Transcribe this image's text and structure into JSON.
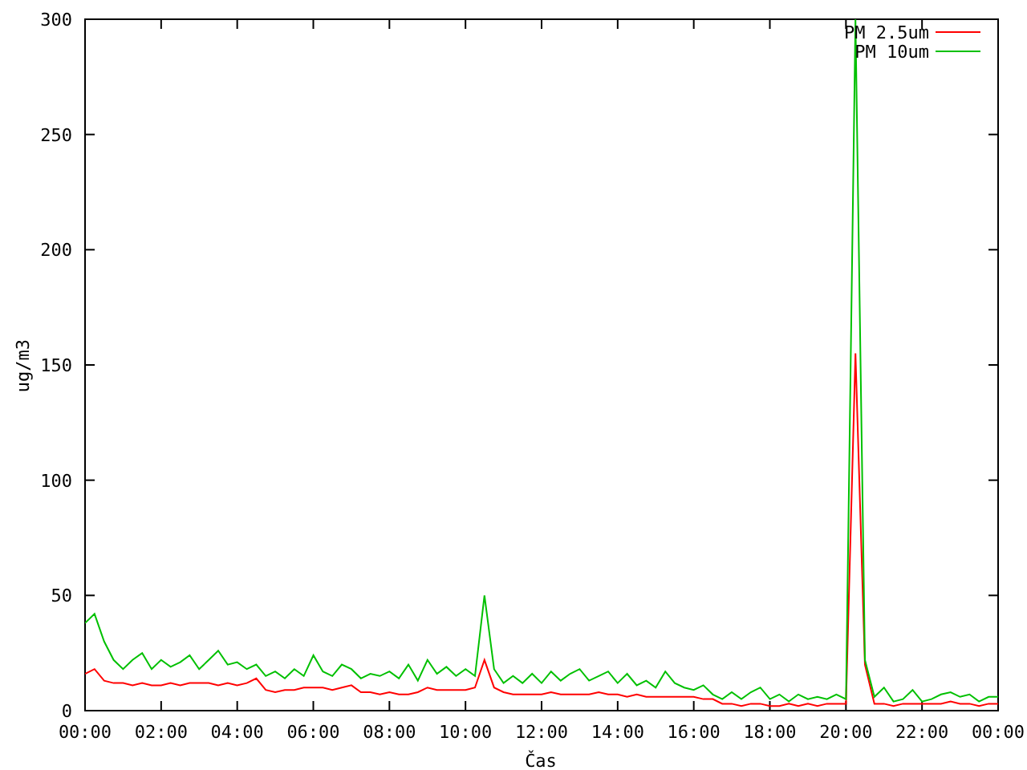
{
  "chart": {
    "chart_data": {
      "type": "line",
      "xlabel": "Čas",
      "ylabel": "ug/m3",
      "x": [
        0,
        0.25,
        0.5,
        0.75,
        1,
        1.25,
        1.5,
        1.75,
        2,
        2.25,
        2.5,
        2.75,
        3,
        3.25,
        3.5,
        3.75,
        4,
        4.25,
        4.5,
        4.75,
        5,
        5.25,
        5.5,
        5.75,
        6,
        6.25,
        6.5,
        6.75,
        7,
        7.25,
        7.5,
        7.75,
        8,
        8.25,
        8.5,
        8.75,
        9,
        9.25,
        9.5,
        9.75,
        10,
        10.25,
        10.5,
        10.75,
        11,
        11.25,
        11.5,
        11.75,
        12,
        12.25,
        12.5,
        12.75,
        13,
        13.25,
        13.5,
        13.75,
        14,
        14.25,
        14.5,
        14.75,
        15,
        15.25,
        15.5,
        15.75,
        16,
        16.25,
        16.5,
        16.75,
        17,
        17.25,
        17.5,
        17.75,
        18,
        18.25,
        18.5,
        18.75,
        19,
        19.25,
        19.5,
        19.75,
        20,
        20.25,
        20.5,
        20.75,
        21,
        21.25,
        21.5,
        21.75,
        22,
        22.25,
        22.5,
        22.75,
        23,
        23.25,
        23.5,
        23.75,
        24
      ],
      "series": [
        {
          "name": "PM 2.5um",
          "color": "#ff0000",
          "values": [
            16,
            18,
            13,
            12,
            12,
            11,
            12,
            11,
            11,
            12,
            11,
            12,
            12,
            12,
            11,
            12,
            11,
            12,
            14,
            9,
            8,
            9,
            9,
            10,
            10,
            10,
            9,
            10,
            11,
            8,
            8,
            7,
            8,
            7,
            7,
            8,
            10,
            9,
            9,
            9,
            9,
            10,
            22,
            10,
            8,
            7,
            7,
            7,
            7,
            8,
            7,
            7,
            7,
            7,
            8,
            7,
            7,
            6,
            7,
            6,
            6,
            6,
            6,
            6,
            6,
            5,
            5,
            3,
            3,
            2,
            3,
            3,
            2,
            2,
            3,
            2,
            3,
            2,
            3,
            3,
            3,
            155,
            20,
            3,
            3,
            2,
            3,
            3,
            3,
            3,
            3,
            4,
            3,
            3,
            2,
            3,
            3
          ]
        },
        {
          "name": "PM 10um",
          "color": "#00c000",
          "values": [
            38,
            42,
            30,
            22,
            18,
            22,
            25,
            18,
            22,
            19,
            21,
            24,
            18,
            22,
            26,
            20,
            21,
            18,
            20,
            15,
            17,
            14,
            18,
            15,
            24,
            17,
            15,
            20,
            18,
            14,
            16,
            15,
            17,
            14,
            20,
            13,
            22,
            16,
            19,
            15,
            18,
            15,
            50,
            18,
            12,
            15,
            12,
            16,
            12,
            17,
            13,
            16,
            18,
            13,
            15,
            17,
            12,
            16,
            11,
            13,
            10,
            17,
            12,
            10,
            9,
            11,
            7,
            5,
            8,
            5,
            8,
            10,
            5,
            7,
            4,
            7,
            5,
            6,
            5,
            7,
            5,
            300,
            22,
            6,
            10,
            4,
            5,
            9,
            4,
            5,
            7,
            8,
            6,
            7,
            4,
            6,
            6
          ]
        }
      ],
      "legend": true,
      "xlim": [
        0,
        24
      ],
      "ylim": [
        0,
        300
      ],
      "xticks": [
        {
          "value": 0,
          "label": "00:00"
        },
        {
          "value": 2,
          "label": "02:00"
        },
        {
          "value": 4,
          "label": "04:00"
        },
        {
          "value": 6,
          "label": "06:00"
        },
        {
          "value": 8,
          "label": "08:00"
        },
        {
          "value": 10,
          "label": "10:00"
        },
        {
          "value": 12,
          "label": "12:00"
        },
        {
          "value": 14,
          "label": "14:00"
        },
        {
          "value": 16,
          "label": "16:00"
        },
        {
          "value": 18,
          "label": "18:00"
        },
        {
          "value": 20,
          "label": "20:00"
        },
        {
          "value": 22,
          "label": "22:00"
        },
        {
          "value": 24,
          "label": "00:00"
        }
      ],
      "yticks": [
        0,
        50,
        100,
        150,
        200,
        250,
        300
      ]
    }
  }
}
